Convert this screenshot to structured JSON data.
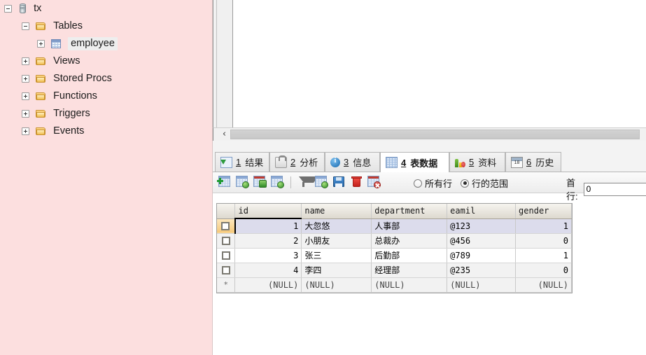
{
  "tree": {
    "items": [
      {
        "label": "tx",
        "icon": "database-icon",
        "indent": 0,
        "expander": "minus",
        "selected": false
      },
      {
        "label": "Tables",
        "icon": "folder-icon",
        "indent": 1,
        "expander": "minus",
        "selected": false
      },
      {
        "label": "employee",
        "icon": "table-grid-icon",
        "indent": 2,
        "expander": "plus",
        "selected": true
      },
      {
        "label": "Views",
        "icon": "folder-icon",
        "indent": 1,
        "expander": "plus",
        "selected": false
      },
      {
        "label": "Stored Procs",
        "icon": "folder-icon",
        "indent": 1,
        "expander": "plus",
        "selected": false
      },
      {
        "label": "Functions",
        "icon": "folder-icon",
        "indent": 1,
        "expander": "plus",
        "selected": false
      },
      {
        "label": "Triggers",
        "icon": "folder-icon",
        "indent": 1,
        "expander": "plus",
        "selected": false
      },
      {
        "label": "Events",
        "icon": "folder-icon",
        "indent": 1,
        "expander": "plus",
        "selected": false
      }
    ]
  },
  "scrollbar": {
    "left_arrow": "‹"
  },
  "tabs": [
    {
      "num": "1",
      "label": "结果",
      "icon": "result-grid-icon",
      "active": false
    },
    {
      "num": "2",
      "label": "分析",
      "icon": "profile-lock-icon",
      "active": false
    },
    {
      "num": "3",
      "label": "信息",
      "icon": "info-icon",
      "active": false
    },
    {
      "num": "4",
      "label": "表数据",
      "icon": "table-data-icon",
      "active": true
    },
    {
      "num": "5",
      "label": "资料",
      "icon": "chart-icon",
      "active": false
    },
    {
      "num": "6",
      "label": "历史",
      "icon": "calendar-icon",
      "active": false
    }
  ],
  "toolbar": {
    "buttons": [
      {
        "name": "add-record-button",
        "icon": "grid-add-icon"
      },
      {
        "name": "apply-changes-button",
        "icon": "grid-apply-icon"
      },
      {
        "name": "copy-record-button",
        "icon": "grid-copy-icon"
      },
      {
        "name": "refresh-grid-button",
        "icon": "grid-refresh-icon"
      },
      {
        "name": "filter-button",
        "icon": "funnel-icon"
      },
      {
        "name": "edit-record-button",
        "icon": "grid-edit-icon"
      },
      {
        "name": "save-button",
        "icon": "floppy-disk-icon"
      },
      {
        "name": "delete-record-button",
        "icon": "trash-icon"
      },
      {
        "name": "cancel-changes-button",
        "icon": "grid-cancel-icon"
      }
    ],
    "radios": [
      {
        "label": "所有行",
        "selected": false
      },
      {
        "label": "行的范围",
        "selected": true
      }
    ],
    "first_row_label": "首行:",
    "first_row_value": "0"
  },
  "grid": {
    "columns": [
      {
        "name": "id",
        "primary_key": true
      },
      {
        "name": "name",
        "primary_key": false
      },
      {
        "name": "department",
        "primary_key": false
      },
      {
        "name": "eamil",
        "primary_key": false
      },
      {
        "name": "gender",
        "primary_key": false
      }
    ],
    "rows": [
      {
        "id": "1",
        "name": "大忽悠",
        "department": "人事部",
        "eamil": "@123",
        "gender": "1",
        "current": true
      },
      {
        "id": "2",
        "name": "小朋友",
        "department": "总裁办",
        "eamil": "@456",
        "gender": "0",
        "current": false
      },
      {
        "id": "3",
        "name": "张三",
        "department": "后勤部",
        "eamil": "@789",
        "gender": "1",
        "current": false
      },
      {
        "id": "4",
        "name": "李四",
        "department": "经理部",
        "eamil": "@235",
        "gender": "0",
        "current": false
      }
    ],
    "new_row": {
      "marker": "*",
      "id": "(NULL)",
      "name": "(NULL)",
      "department": "(NULL)",
      "eamil": "(NULL)",
      "gender": "(NULL)"
    }
  },
  "colors": {
    "tree_panel_bg": "#fcdfdf",
    "pk_header": "#f6c97a",
    "selected_row": "#dcdcec",
    "accent": "#2f8b27"
  }
}
